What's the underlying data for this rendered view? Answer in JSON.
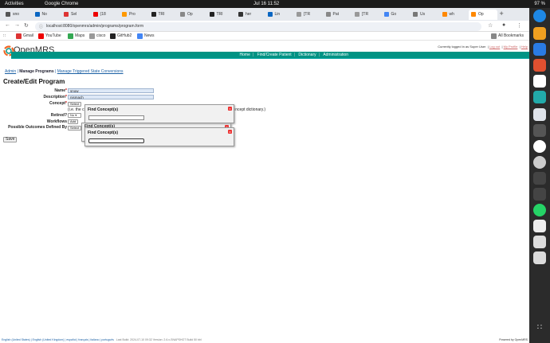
{
  "system": {
    "activities": "Activities",
    "app_name": "Google Chrome",
    "clock": "Jul 16  11:52",
    "battery": "97 %"
  },
  "tabs": [
    {
      "label": "sno",
      "color": "#555"
    },
    {
      "label": "No",
      "color": "#0a66c2"
    },
    {
      "label": "Sel",
      "color": "#d33"
    },
    {
      "label": "(18",
      "color": "#e00"
    },
    {
      "label": "Pro",
      "color": "#f90"
    },
    {
      "label": "TRI",
      "color": "#222"
    },
    {
      "label": "Op",
      "color": "#888"
    },
    {
      "label": "TRI",
      "color": "#222"
    },
    {
      "label": "her",
      "color": "#333"
    },
    {
      "label": "Lin",
      "color": "#0a66c2"
    },
    {
      "label": "[TR",
      "color": "#999"
    },
    {
      "label": "Pat",
      "color": "#888"
    },
    {
      "label": "[TR",
      "color": "#999"
    },
    {
      "label": "Go",
      "color": "#4285f4"
    },
    {
      "label": "Us",
      "color": "#777"
    },
    {
      "label": "wh",
      "color": "#f80"
    },
    {
      "label": "Op",
      "color": "#f80"
    }
  ],
  "toolbar": {
    "url": "localhost:8080/openmrs/admin/programs/program.form"
  },
  "bookmarks": [
    {
      "label": "Gmail",
      "color": "#d33"
    },
    {
      "label": "YouTube",
      "color": "#e00"
    },
    {
      "label": "Maps",
      "color": "#34a853"
    },
    {
      "label": "cisco",
      "color": "#999"
    },
    {
      "label": "GitHub2",
      "color": "#222"
    },
    {
      "label": "News",
      "color": "#4285f4"
    }
  ],
  "all_bookmarks": "All Bookmarks",
  "openmrs": {
    "logo_text": "OpenMRS",
    "user_line": "Currently logged in as Super User",
    "log_out": "Log out",
    "my_profile": "My Profile",
    "help": "Help",
    "menu": [
      "Home",
      "Find/Create Patient",
      "Dictionary",
      "Administration"
    ],
    "breadcrumb": {
      "admin": "Admin",
      "manage_programs": "Manage Programs",
      "manage_triggered": "Manage Triggered State Conversions"
    },
    "heading": "Create/Edit Program",
    "form": {
      "name_label": "Name",
      "name_value": "snow",
      "description_label": "Description",
      "description_value": "nismach",
      "concept_label": "Concept",
      "select_btn": "Select",
      "concept_note_left": "(i.e. the c",
      "concept_note_right": "concept dictionary.)",
      "retired_label": "Retired?",
      "retired_value": "No",
      "workflows_label": "Workflows",
      "add_btn": "Add",
      "outcomes_label": "Possible Outcomes Defined By",
      "outcomes_select": "Select",
      "save_btn": "Save"
    },
    "dialogs": {
      "find_concept_title": "Find Concept(s)",
      "find_concept_title_hidden": "Find Concept(s)",
      "close": "x"
    },
    "footer_links": "English (United States) | English (United Kingdom) | español | français | italiano | português",
    "footer_meta": "Last Build: 2024-07-10 09:32   Version: 2.6.x-SNAPSHOT Build 50 bbl",
    "powered_by": "Powered by OpenMRS"
  }
}
